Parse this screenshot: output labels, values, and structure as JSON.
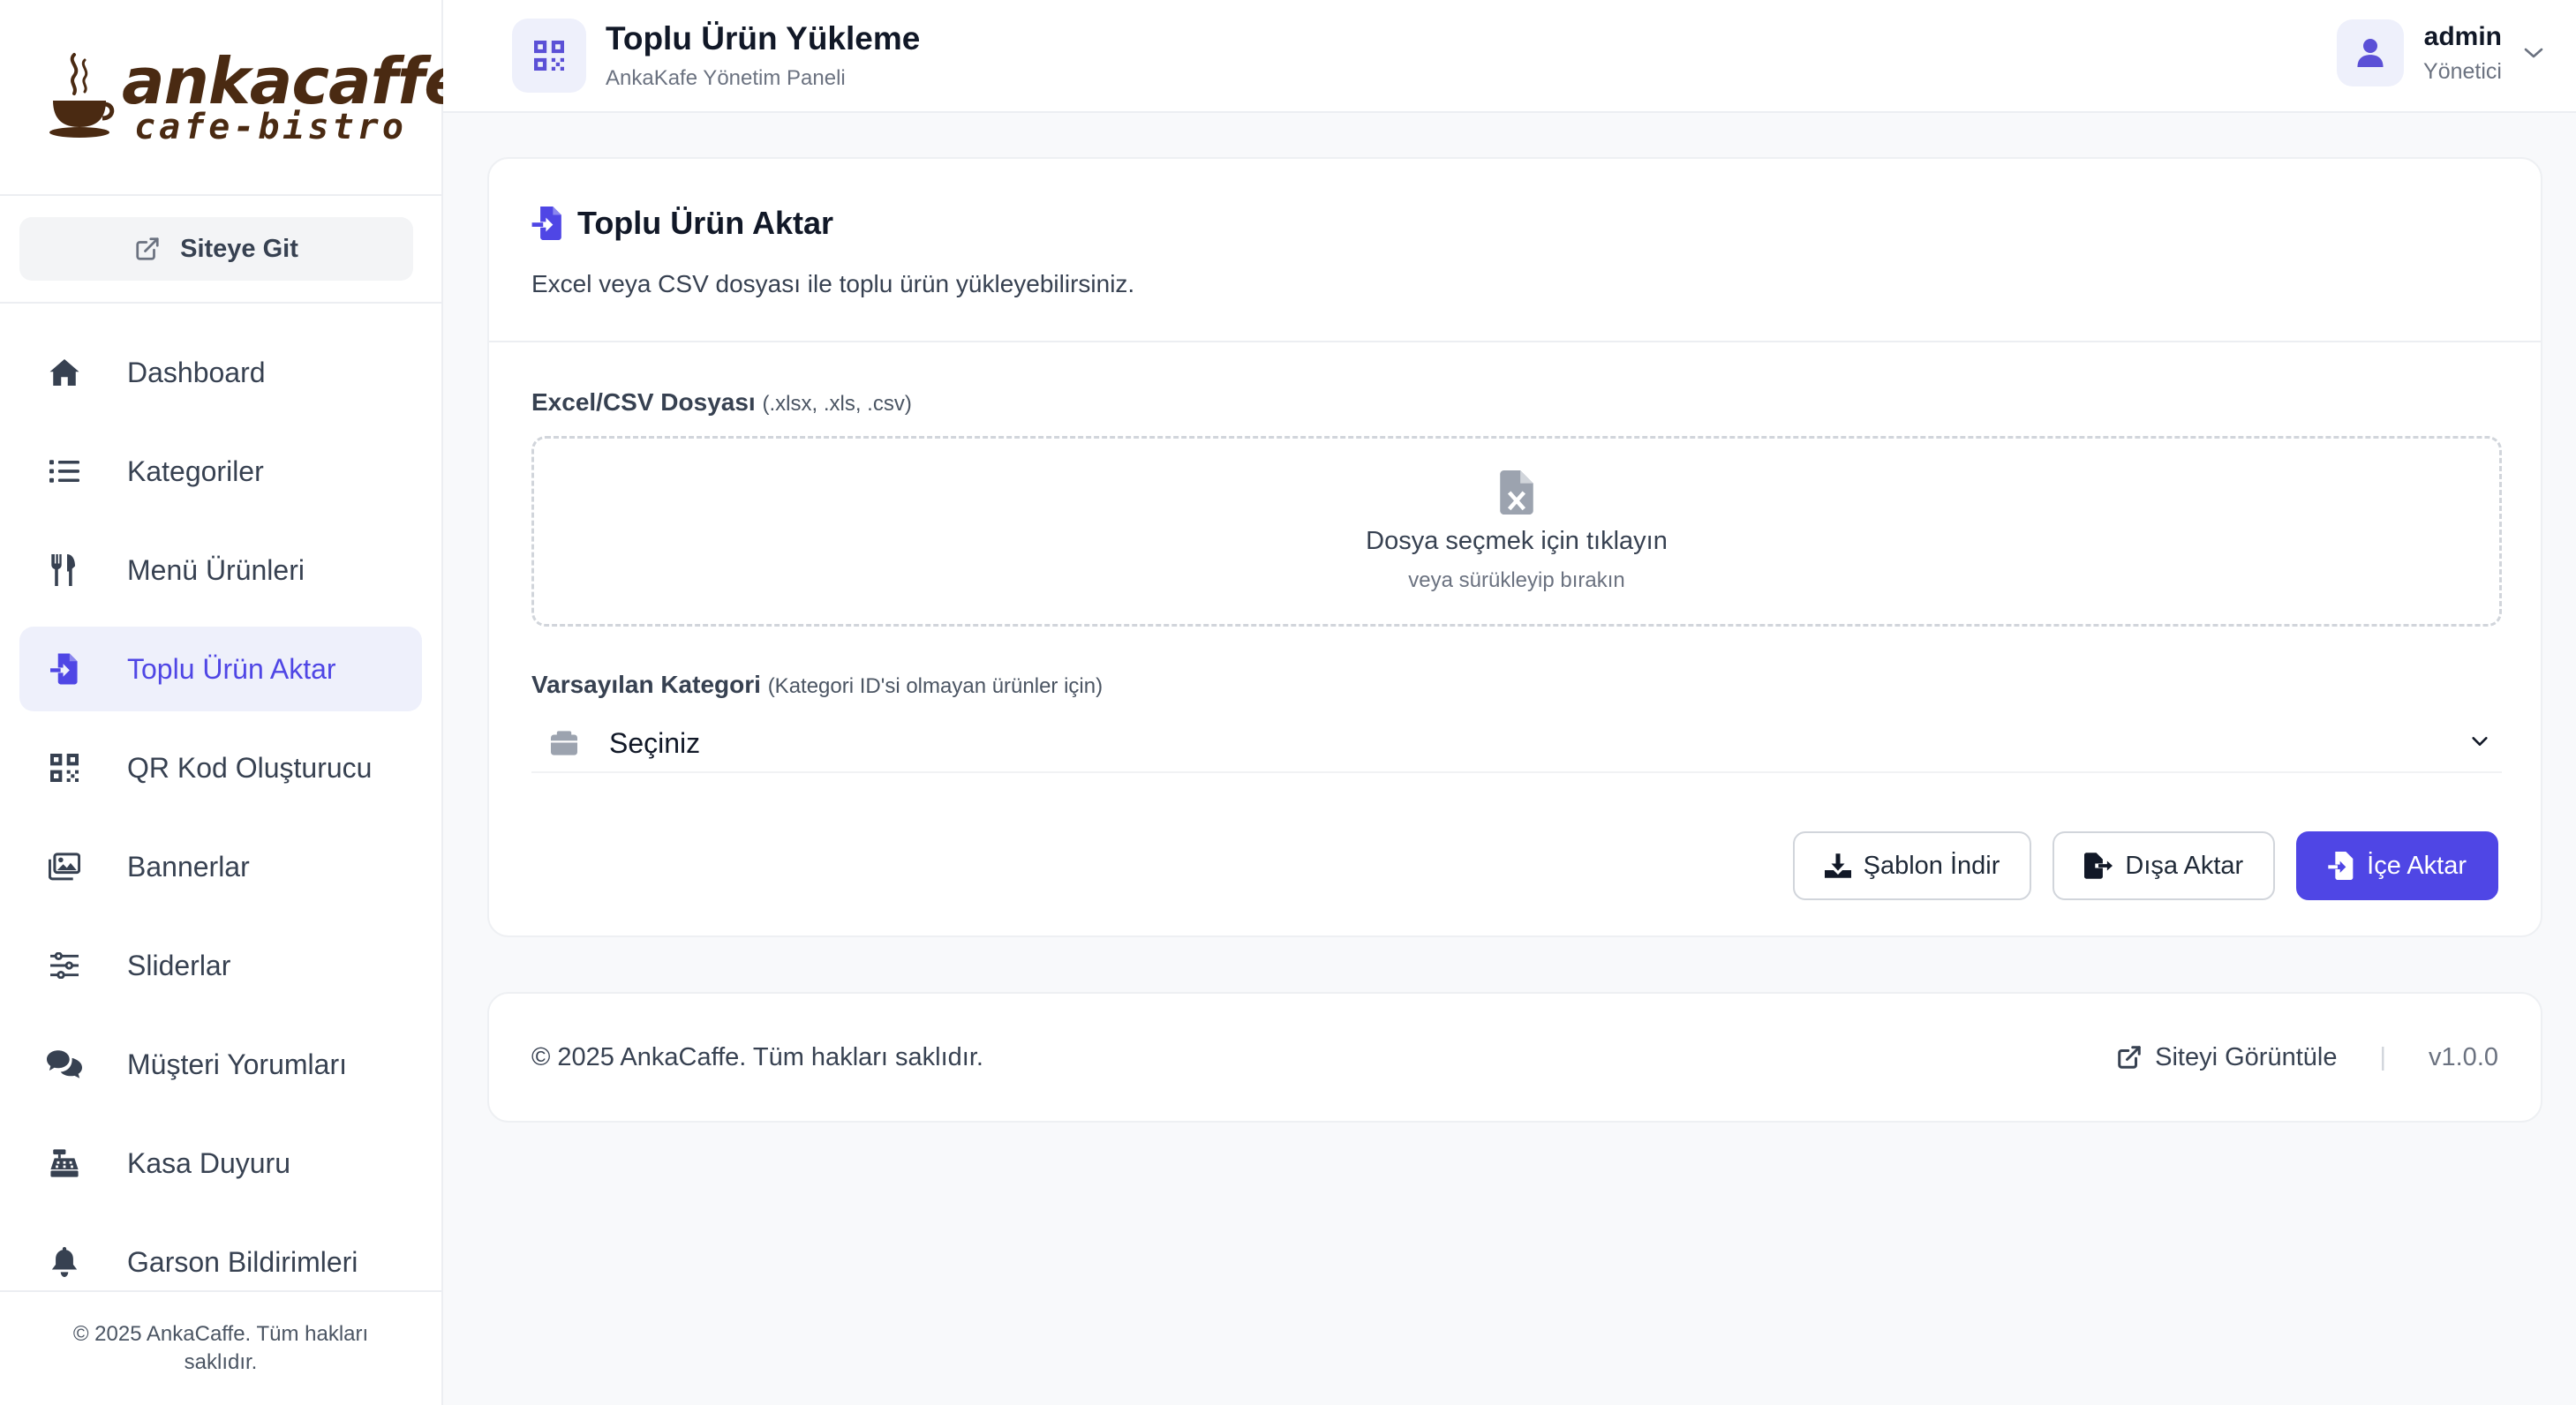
{
  "brand": {
    "logo_main": "ankacaffe",
    "logo_sub": "cafe-bistro"
  },
  "sidebar": {
    "site_link": "Siteye Git",
    "items": [
      {
        "label": "Dashboard",
        "icon": "home-icon",
        "active": false
      },
      {
        "label": "Kategoriler",
        "icon": "list-icon",
        "active": false
      },
      {
        "label": "Menü Ürünleri",
        "icon": "utensils-icon",
        "active": false
      },
      {
        "label": "Toplu Ürün Aktar",
        "icon": "file-import-icon",
        "active": true
      },
      {
        "label": "QR Kod Oluşturucu",
        "icon": "qrcode-icon",
        "active": false
      },
      {
        "label": "Bannerlar",
        "icon": "images-icon",
        "active": false
      },
      {
        "label": "Sliderlar",
        "icon": "sliders-icon",
        "active": false
      },
      {
        "label": "Müşteri Yorumları",
        "icon": "comments-icon",
        "active": false
      },
      {
        "label": "Kasa Duyuru",
        "icon": "cash-register-icon",
        "active": false
      },
      {
        "label": "Garson Bildirimleri",
        "icon": "bell-icon",
        "active": false
      }
    ],
    "footer": "© 2025 AnkaCaffe. Tüm hakları saklıdır."
  },
  "header": {
    "title": "Toplu Ürün Yükleme",
    "subtitle": "AnkaKafe Yönetim Paneli",
    "user_name": "admin",
    "user_role": "Yönetici"
  },
  "card": {
    "title": "Toplu Ürün Aktar",
    "description": "Excel veya CSV dosyası ile toplu ürün yükleyebilirsiniz.",
    "file_label": "Excel/CSV Dosyası",
    "file_hint": "(.xlsx, .xls, .csv)",
    "dropzone_title": "Dosya seçmek için tıklayın",
    "dropzone_sub": "veya sürükleyip bırakın",
    "category_label": "Varsayılan Kategori",
    "category_hint": "(Kategori ID'si olmayan ürünler için)",
    "category_value": "Seçiniz",
    "buttons": {
      "template": "Şablon İndir",
      "export": "Dışa Aktar",
      "import": "İçe Aktar"
    }
  },
  "footer": {
    "copyright": "© 2025 AnkaCaffe. Tüm hakları saklıdır.",
    "view_site": "Siteyi Görüntüle",
    "version": "v1.0.0"
  },
  "colors": {
    "accent": "#4f46e5",
    "active_bg": "#eef0fb",
    "logo_brown": "#4a2a12"
  }
}
